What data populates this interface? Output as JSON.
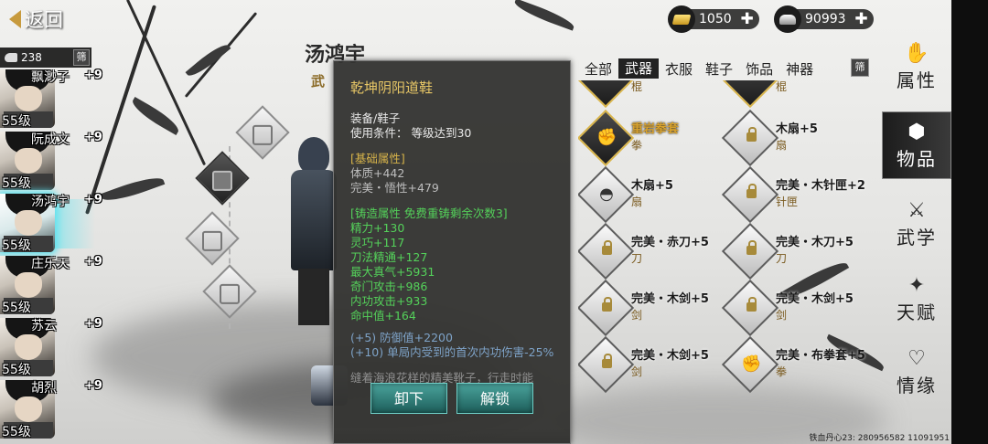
{
  "top_bar": {
    "back_label": "返回"
  },
  "currency": {
    "gold": "1050",
    "silver": "90993"
  },
  "roster": {
    "count": "238",
    "filter_label": "筛",
    "heroes": [
      {
        "name": "飘渺子",
        "bonus": "+9",
        "level": "55级"
      },
      {
        "name": "阮成文",
        "bonus": "+9",
        "level": "55级"
      },
      {
        "name": "汤鸿宇",
        "bonus": "+9",
        "level": "55级"
      },
      {
        "name": "庄乐天",
        "bonus": "+9",
        "level": "55级"
      },
      {
        "name": "苏云",
        "bonus": "+9",
        "level": "55级"
      },
      {
        "name": "胡烈",
        "bonus": "+9",
        "level": "55级"
      }
    ]
  },
  "character": {
    "name": "汤鸿宇",
    "subtitle": "武"
  },
  "tooltip": {
    "title": "乾坤阴阳道鞋",
    "slot": "装备/鞋子",
    "requirement": "使用条件：   等级达到30",
    "base_header": "[基础属性]",
    "base_attrs": [
      "体质+442",
      "完美・悟性+479"
    ],
    "forge_header": "[铸造属性  免费重铸剩余次数3]",
    "forge_attrs": [
      "精力+130",
      "灵巧+117",
      "刀法精通+127",
      "最大真气+5931",
      "奇门攻击+986",
      "内功攻击+933",
      "命中值+164"
    ],
    "set_bonus": [
      "(+5) 防御值+2200",
      "(+10) 单局内受到的首次内功伤害-25%"
    ],
    "description": "缝着海浪花样的精美靴子，行走时能",
    "unequip_label": "卸下",
    "unlock_label": "解锁"
  },
  "categories": {
    "tabs": [
      "全部",
      "武器",
      "衣服",
      "鞋子",
      "饰品",
      "神器"
    ],
    "active": "武器",
    "filter_label": "筛"
  },
  "items": [
    {
      "name": "",
      "type": "棍",
      "rare": true,
      "glyph": "staff-icon"
    },
    {
      "name": "",
      "type": "棍",
      "rare": true,
      "glyph": "staff-icon"
    },
    {
      "name": "重岩拳套",
      "type": "拳",
      "rare": true,
      "glyph": "gauntlet-icon"
    },
    {
      "name": "木扇+5",
      "type": "扇",
      "rare": false,
      "glyph": "fan-icon"
    },
    {
      "name": "木扇+5",
      "type": "扇",
      "rare": false,
      "glyph": "fan-icon"
    },
    {
      "name": "完美・木针匣+2",
      "type": "针匣",
      "rare": false,
      "glyph": "box-icon"
    },
    {
      "name": "完美・赤刀+5",
      "type": "刀",
      "rare": false,
      "glyph": "blade-icon"
    },
    {
      "name": "完美・木刀+5",
      "type": "刀",
      "rare": false,
      "glyph": "blade-icon"
    },
    {
      "name": "完美・木剑+5",
      "type": "剑",
      "rare": false,
      "glyph": "sword-icon"
    },
    {
      "name": "完美・木剑+5",
      "type": "剑",
      "rare": false,
      "glyph": "sword-icon"
    },
    {
      "name": "完美・木剑+5",
      "type": "剑",
      "rare": false,
      "glyph": "sword-icon"
    },
    {
      "name": "完美・布拳套+5",
      "type": "拳",
      "rare": false,
      "glyph": "gauntlet-icon"
    }
  ],
  "right_nav": [
    {
      "label": "属性",
      "icon": "attribute-icon"
    },
    {
      "label": "物品",
      "icon": "item-box-icon"
    },
    {
      "label": "武学",
      "icon": "martial-icon"
    },
    {
      "label": "天赋",
      "icon": "talent-icon"
    },
    {
      "label": "情缘",
      "icon": "heart-icon"
    }
  ],
  "footer": {
    "info": "铁血丹心23: 280956582 11091951"
  }
}
